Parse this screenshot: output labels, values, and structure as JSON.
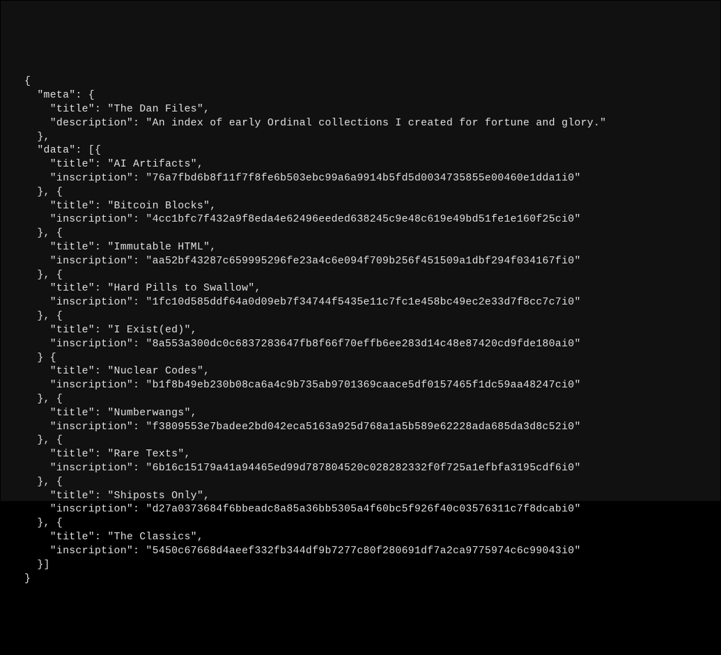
{
  "code": {
    "meta": {
      "title": "The Dan Files",
      "description": "An index of early Ordinal collections I created for fortune and glory."
    },
    "data": [
      {
        "title": "AI Artifacts",
        "inscription": "76a7fbd6b8f11f7f8fe6b503ebc99a6a9914b5fd5d0034735855e00460e1dda1i0",
        "closer": ", {"
      },
      {
        "title": "Bitcoin Blocks",
        "inscription": "4cc1bfc7f432a9f8eda4e62496eeded638245c9e48c619e49bd51fe1e160f25ci0",
        "closer": ", {"
      },
      {
        "title": "Immutable HTML",
        "inscription": "aa52bf43287c659995296fe23a4c6e094f709b256f451509a1dbf294f034167fi0",
        "closer": ", {"
      },
      {
        "title": "Hard Pills to Swallow",
        "inscription": "1fc10d585ddf64a0d09eb7f34744f5435e11c7fc1e458bc49ec2e33d7f8cc7c7i0",
        "closer": ", {"
      },
      {
        "title": "I Exist(ed)",
        "inscription": "8a553a300dc0c6837283647fb8f66f70effb6ee283d14c48e87420cd9fde180ai0",
        "closer": " {"
      },
      {
        "title": "Nuclear Codes",
        "inscription": "b1f8b49eb230b08ca6a4c9b735ab9701369caace5df0157465f1dc59aa48247ci0",
        "closer": ", {"
      },
      {
        "title": "Numberwangs",
        "inscription": "f3809553e7badee2bd042eca5163a925d768a1a5b589e62228ada685da3d8c52i0",
        "closer": ", {"
      },
      {
        "title": "Rare Texts",
        "inscription": "6b16c15179a41a94465ed99d787804520c028282332f0f725a1efbfa3195cdf6i0",
        "closer": ", {"
      },
      {
        "title": "Shiposts Only",
        "inscription": "d27a0373684f6bbeadc8a85a36bb5305a4f60bc5f926f40c03576311c7f8dcabi0",
        "closer": ", {"
      },
      {
        "title": "The Classics",
        "inscription": "5450c67668d4aeef332fb344df9b7277c80f280691df7a2ca9775974c6c99043i0",
        "closer": "]"
      }
    ]
  }
}
